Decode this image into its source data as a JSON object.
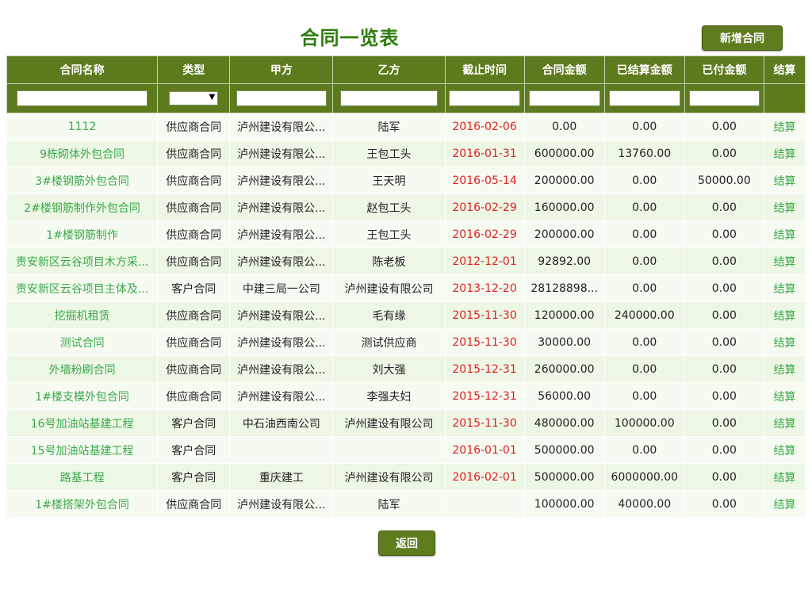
{
  "title": "合同一览表",
  "add_button": "新增合同",
  "back_button": "返回",
  "columns": [
    "合同名称",
    "类型",
    "甲方",
    "乙方",
    "截止时间",
    "合同金额",
    "已结算金额",
    "已付金额",
    "结算"
  ],
  "rows": [
    {
      "name": "1112",
      "type": "供应商合同",
      "party_a": "泸州建设有限公...",
      "party_b": "陆军",
      "deadline": "2016-02-06",
      "amount": "0.00",
      "settled": "0.00",
      "paid": "0.00",
      "action": "结算"
    },
    {
      "name": "9栋砌体外包合同",
      "type": "供应商合同",
      "party_a": "泸州建设有限公...",
      "party_b": "王包工头",
      "deadline": "2016-01-31",
      "amount": "600000.00",
      "settled": "13760.00",
      "paid": "0.00",
      "action": "结算"
    },
    {
      "name": "3#楼钢筋外包合同",
      "type": "供应商合同",
      "party_a": "泸州建设有限公...",
      "party_b": "王天明",
      "deadline": "2016-05-14",
      "amount": "200000.00",
      "settled": "0.00",
      "paid": "50000.00",
      "action": "结算"
    },
    {
      "name": "2#楼钢筋制作外包合同",
      "type": "供应商合同",
      "party_a": "泸州建设有限公...",
      "party_b": "赵包工头",
      "deadline": "2016-02-29",
      "amount": "160000.00",
      "settled": "0.00",
      "paid": "0.00",
      "action": "结算"
    },
    {
      "name": "1#楼钢筋制作",
      "type": "供应商合同",
      "party_a": "泸州建设有限公...",
      "party_b": "王包工头",
      "deadline": "2016-02-29",
      "amount": "200000.00",
      "settled": "0.00",
      "paid": "0.00",
      "action": "结算"
    },
    {
      "name": "贵安新区云谷项目木方采...",
      "type": "供应商合同",
      "party_a": "泸州建设有限公...",
      "party_b": "陈老板",
      "deadline": "2012-12-01",
      "amount": "92892.00",
      "settled": "0.00",
      "paid": "0.00",
      "action": "结算"
    },
    {
      "name": "贵安新区云谷项目主体及...",
      "type": "客户合同",
      "party_a": "中建三局一公司",
      "party_b": "泸州建设有限公司",
      "deadline": "2013-12-20",
      "amount": "28128898...",
      "settled": "0.00",
      "paid": "0.00",
      "action": "结算"
    },
    {
      "name": "挖掘机租赁",
      "type": "供应商合同",
      "party_a": "泸州建设有限公...",
      "party_b": "毛有缘",
      "deadline": "2015-11-30",
      "amount": "120000.00",
      "settled": "240000.00",
      "paid": "0.00",
      "action": "结算"
    },
    {
      "name": "测试合同",
      "type": "供应商合同",
      "party_a": "泸州建设有限公...",
      "party_b": "测试供应商",
      "deadline": "2015-11-30",
      "amount": "30000.00",
      "settled": "0.00",
      "paid": "0.00",
      "action": "结算"
    },
    {
      "name": "外墙粉刷合同",
      "type": "供应商合同",
      "party_a": "泸州建设有限公...",
      "party_b": "刘大强",
      "deadline": "2015-12-31",
      "amount": "260000.00",
      "settled": "0.00",
      "paid": "0.00",
      "action": "结算"
    },
    {
      "name": "1#楼支模外包合同",
      "type": "供应商合同",
      "party_a": "泸州建设有限公...",
      "party_b": "李强夫妇",
      "deadline": "2015-12-31",
      "amount": "56000.00",
      "settled": "0.00",
      "paid": "0.00",
      "action": "结算"
    },
    {
      "name": "16号加油站基建工程",
      "type": "客户合同",
      "party_a": "中石油西南公司",
      "party_b": "泸州建设有限公司",
      "deadline": "2015-11-30",
      "amount": "480000.00",
      "settled": "100000.00",
      "paid": "0.00",
      "action": "结算"
    },
    {
      "name": "15号加油站基建工程",
      "type": "客户合同",
      "party_a": "",
      "party_b": "",
      "deadline": "2016-01-01",
      "amount": "500000.00",
      "settled": "0.00",
      "paid": "0.00",
      "action": "结算"
    },
    {
      "name": "路基工程",
      "type": "客户合同",
      "party_a": "重庆建工",
      "party_b": "泸州建设有限公司",
      "deadline": "2016-02-01",
      "amount": "500000.00",
      "settled": "6000000.00",
      "paid": "0.00",
      "action": "结算"
    },
    {
      "name": "1#楼搭架外包合同",
      "type": "供应商合同",
      "party_a": "泸州建设有限公...",
      "party_b": "陆军",
      "deadline": "",
      "amount": "100000.00",
      "settled": "40000.00",
      "paid": "0.00",
      "action": "结算"
    }
  ],
  "colors": {
    "header_bg": "#5d7a1d",
    "title": "#2e7d0c",
    "link": "#3aa84a",
    "date": "#e02020"
  }
}
